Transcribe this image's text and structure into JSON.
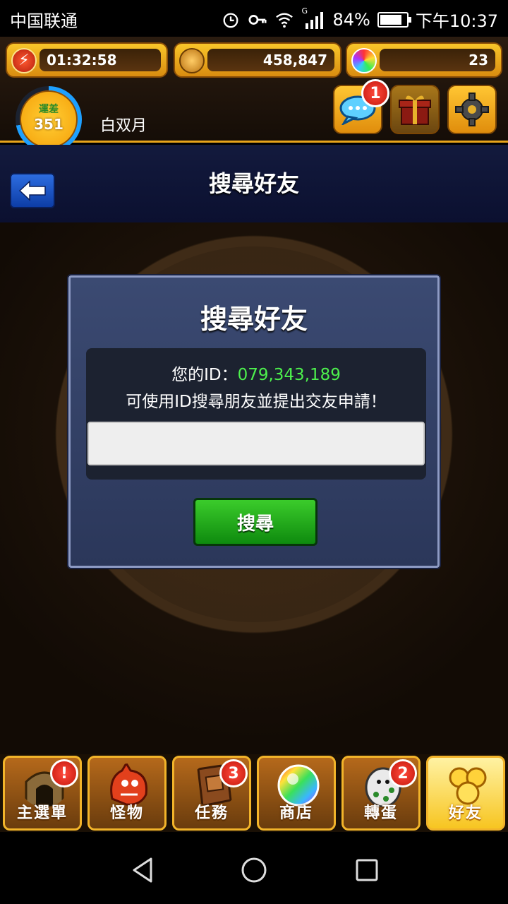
{
  "status_bar": {
    "carrier": "中国联通",
    "network": "G",
    "battery_text": "84%",
    "battery_level": 0.84,
    "time": "下午10:37"
  },
  "header": {
    "stamina_timer": "01:32:58",
    "gold": "458,847",
    "orbs": "23",
    "rank_label": "運差",
    "rank": "351",
    "player_name": "白双月",
    "chat_badge": "1"
  },
  "titlebar": {
    "title": "搜尋好友"
  },
  "dialog": {
    "title": "搜尋好友",
    "id_prefix": "您的ID：",
    "id_value": "079,343,189",
    "hint": "可使用ID搜尋朋友並提出交友申請！",
    "input_value": "",
    "search_label": "搜尋"
  },
  "bottom_nav": [
    {
      "label": "主選單",
      "badge": "!",
      "icon": "gate-icon"
    },
    {
      "label": "怪物",
      "badge": "",
      "icon": "monster-icon"
    },
    {
      "label": "任務",
      "badge": "3",
      "icon": "book-icon"
    },
    {
      "label": "商店",
      "badge": "",
      "icon": "orb-icon"
    },
    {
      "label": "轉蛋",
      "badge": "2",
      "icon": "egg-icon"
    },
    {
      "label": "好友",
      "badge": "",
      "icon": "friends-icon"
    }
  ],
  "colors": {
    "accent": "#f7b71f",
    "id_green": "#4df04d",
    "button_green": "#1ea01a",
    "dialog_bg": "#34406a"
  }
}
